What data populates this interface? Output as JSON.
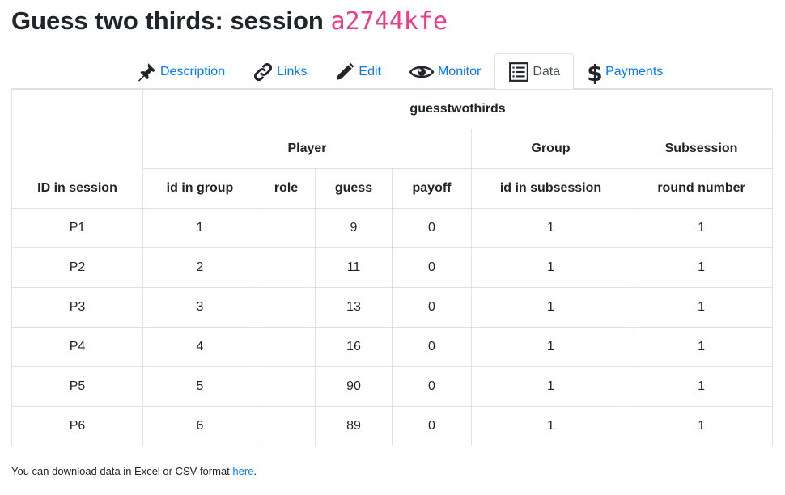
{
  "header": {
    "title_prefix": "Guess two thirds: session",
    "session_code": "a2744kfe"
  },
  "tabs": [
    {
      "label": "Description",
      "icon": "pin-icon",
      "active": false
    },
    {
      "label": "Links",
      "icon": "link-icon",
      "active": false
    },
    {
      "label": "Edit",
      "icon": "pencil-icon",
      "active": false
    },
    {
      "label": "Monitor",
      "icon": "eye-icon",
      "active": false
    },
    {
      "label": "Data",
      "icon": "list-icon",
      "active": true
    },
    {
      "label": "Payments",
      "icon": "dollar-icon",
      "active": false
    }
  ],
  "table": {
    "app_name": "guesstwothirds",
    "id_in_session_header": "ID in session",
    "groups": {
      "player": "Player",
      "group": "Group",
      "subsession": "Subsession"
    },
    "columns": {
      "id_in_group": "id in group",
      "role": "role",
      "guess": "guess",
      "payoff": "payoff",
      "id_in_subsession": "id in subsession",
      "round_number": "round number"
    },
    "rows": [
      {
        "id": "P1",
        "id_in_group": "1",
        "role": "",
        "guess": "9",
        "payoff": "0",
        "id_in_subsession": "1",
        "round_number": "1"
      },
      {
        "id": "P2",
        "id_in_group": "2",
        "role": "",
        "guess": "11",
        "payoff": "0",
        "id_in_subsession": "1",
        "round_number": "1"
      },
      {
        "id": "P3",
        "id_in_group": "3",
        "role": "",
        "guess": "13",
        "payoff": "0",
        "id_in_subsession": "1",
        "round_number": "1"
      },
      {
        "id": "P4",
        "id_in_group": "4",
        "role": "",
        "guess": "16",
        "payoff": "0",
        "id_in_subsession": "1",
        "round_number": "1"
      },
      {
        "id": "P5",
        "id_in_group": "5",
        "role": "",
        "guess": "90",
        "payoff": "0",
        "id_in_subsession": "1",
        "round_number": "1"
      },
      {
        "id": "P6",
        "id_in_group": "6",
        "role": "",
        "guess": "89",
        "payoff": "0",
        "id_in_subsession": "1",
        "round_number": "1"
      }
    ]
  },
  "footer": {
    "text": "You can download data in Excel or CSV format",
    "link_label": "here",
    "period": "."
  },
  "colors": {
    "link": "#007bff",
    "code": "#e83e8c",
    "border": "#dee2e6"
  }
}
